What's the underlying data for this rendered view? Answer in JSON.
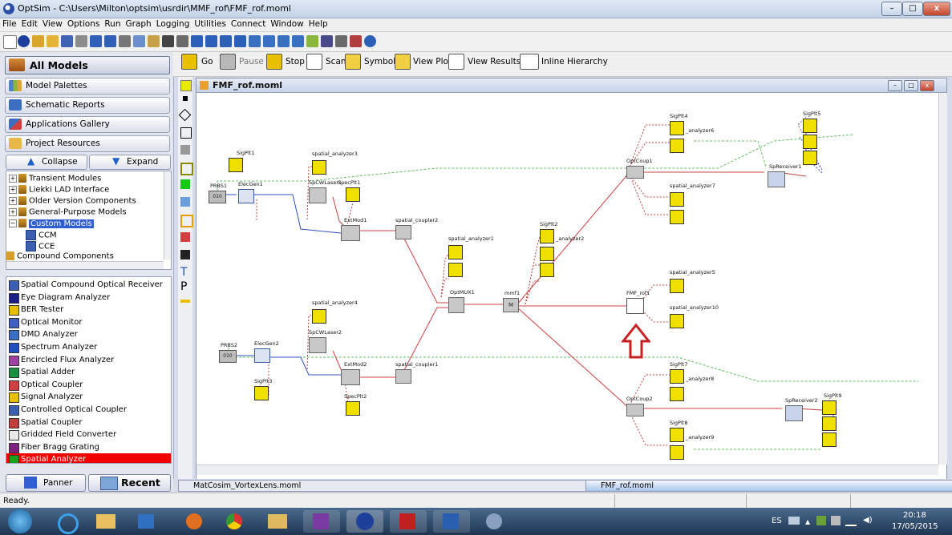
{
  "window": {
    "title": "OptSim - C:\\Users\\Milton\\optsim\\usrdir\\MMF_rof\\FMF_rof.moml"
  },
  "menu": [
    "File",
    "Edit",
    "View",
    "Options",
    "Run",
    "Graph",
    "Logging",
    "Utilities",
    "Connect",
    "Window",
    "Help"
  ],
  "left": {
    "all_models": "All Models",
    "nav": [
      "Model Palettes",
      "Schematic Reports",
      "Applications Gallery",
      "Project Resources"
    ],
    "collapse": "Collapse",
    "expand": "Expand",
    "tree": [
      {
        "label": "Transient Modules",
        "expander": "+"
      },
      {
        "label": "Liekki LAD Interface",
        "expander": "+"
      },
      {
        "label": "Older Version Components",
        "expander": "+"
      },
      {
        "label": "General-Purpose Models",
        "expander": "+"
      },
      {
        "label": "Custom Models",
        "expander": "−"
      },
      {
        "label": "CCM"
      },
      {
        "label": "CCE"
      },
      {
        "label": "Compound Components"
      }
    ],
    "components": [
      "Spatial Compound Optical Receiver",
      "Eye Diagram Analyzer",
      "BER Tester",
      "Optical Monitor",
      "DMD Analyzer",
      "Spectrum Analyzer",
      "Encircled Flux Analyzer",
      "Spatial Adder",
      "Optical Coupler",
      "Signal Analyzer",
      "Controlled Optical Coupler",
      "Spatial Coupler",
      "Gridded Field Converter",
      "Fiber Bragg Grating",
      "Spatial Analyzer"
    ],
    "panner": "Panner",
    "recent": "Recent"
  },
  "simbar": {
    "go": "Go",
    "pause": "Pause",
    "stop": "Stop",
    "scan": "Scan",
    "symbols": "Symbols",
    "view_plot": "View Plot",
    "view_results": "View Results",
    "inline_hierarchy": "Inline Hierarchy"
  },
  "doc": {
    "title": "FMF_rof.moml"
  },
  "schematic": {
    "labels": {
      "sigplt1": "SigPlt1",
      "prbs1": "PRBS1",
      "elecgen1": "ElecGen1",
      "sa3": "spatial_analyzer3",
      "spcw1": "SpCWLaser1",
      "specplt1": "SpecPlt1",
      "extmod1": "ExtMod1",
      "sc2": "spatial_coupler2",
      "sa1": "spatial_analyzer1",
      "optmux1": "OptMUX1",
      "mmf1": "mmf1",
      "sigplt2": "SigPlt2",
      "sa2": "_analyzer2",
      "optcoup1": "OptCoup1",
      "sigplt4": "SigPlt4",
      "sa6": "_analyzer6",
      "sa7": "spatial_analyzer7",
      "sprec1": "SpReceiver1",
      "sigplt5": "SigPlt5",
      "fmf": "FMF_rof1",
      "sa5": "spatial_analyzer5",
      "sa10": "spatial_analyzer10",
      "sa4": "spatial_analyzer4",
      "spcw2": "SpCWLaser2",
      "prbs2": "PRBS2",
      "elecgen2": "ElecGen2",
      "sigplt3": "SigPlt3",
      "extmod2": "ExtMod2",
      "sc1": "spatial_coupler1",
      "specplt2": "SpecPlt2",
      "sigplt7": "SigPlt7",
      "sa8": "_analyzer8",
      "optcoup2": "OptCoup2",
      "sigplt8": "SigPlt8",
      "sa9": "_analyzer9",
      "sprec2": "SpReceiver2",
      "sigplt9": "SigPlt9",
      "prbs_code": "010",
      "mux_m": "M"
    }
  },
  "tabs": [
    "MatCosim_VortexLens.moml",
    "FMF_rof.moml"
  ],
  "status": "Ready.",
  "tray": {
    "lang": "ES",
    "time": "20:18",
    "date": "17/05/2015"
  }
}
